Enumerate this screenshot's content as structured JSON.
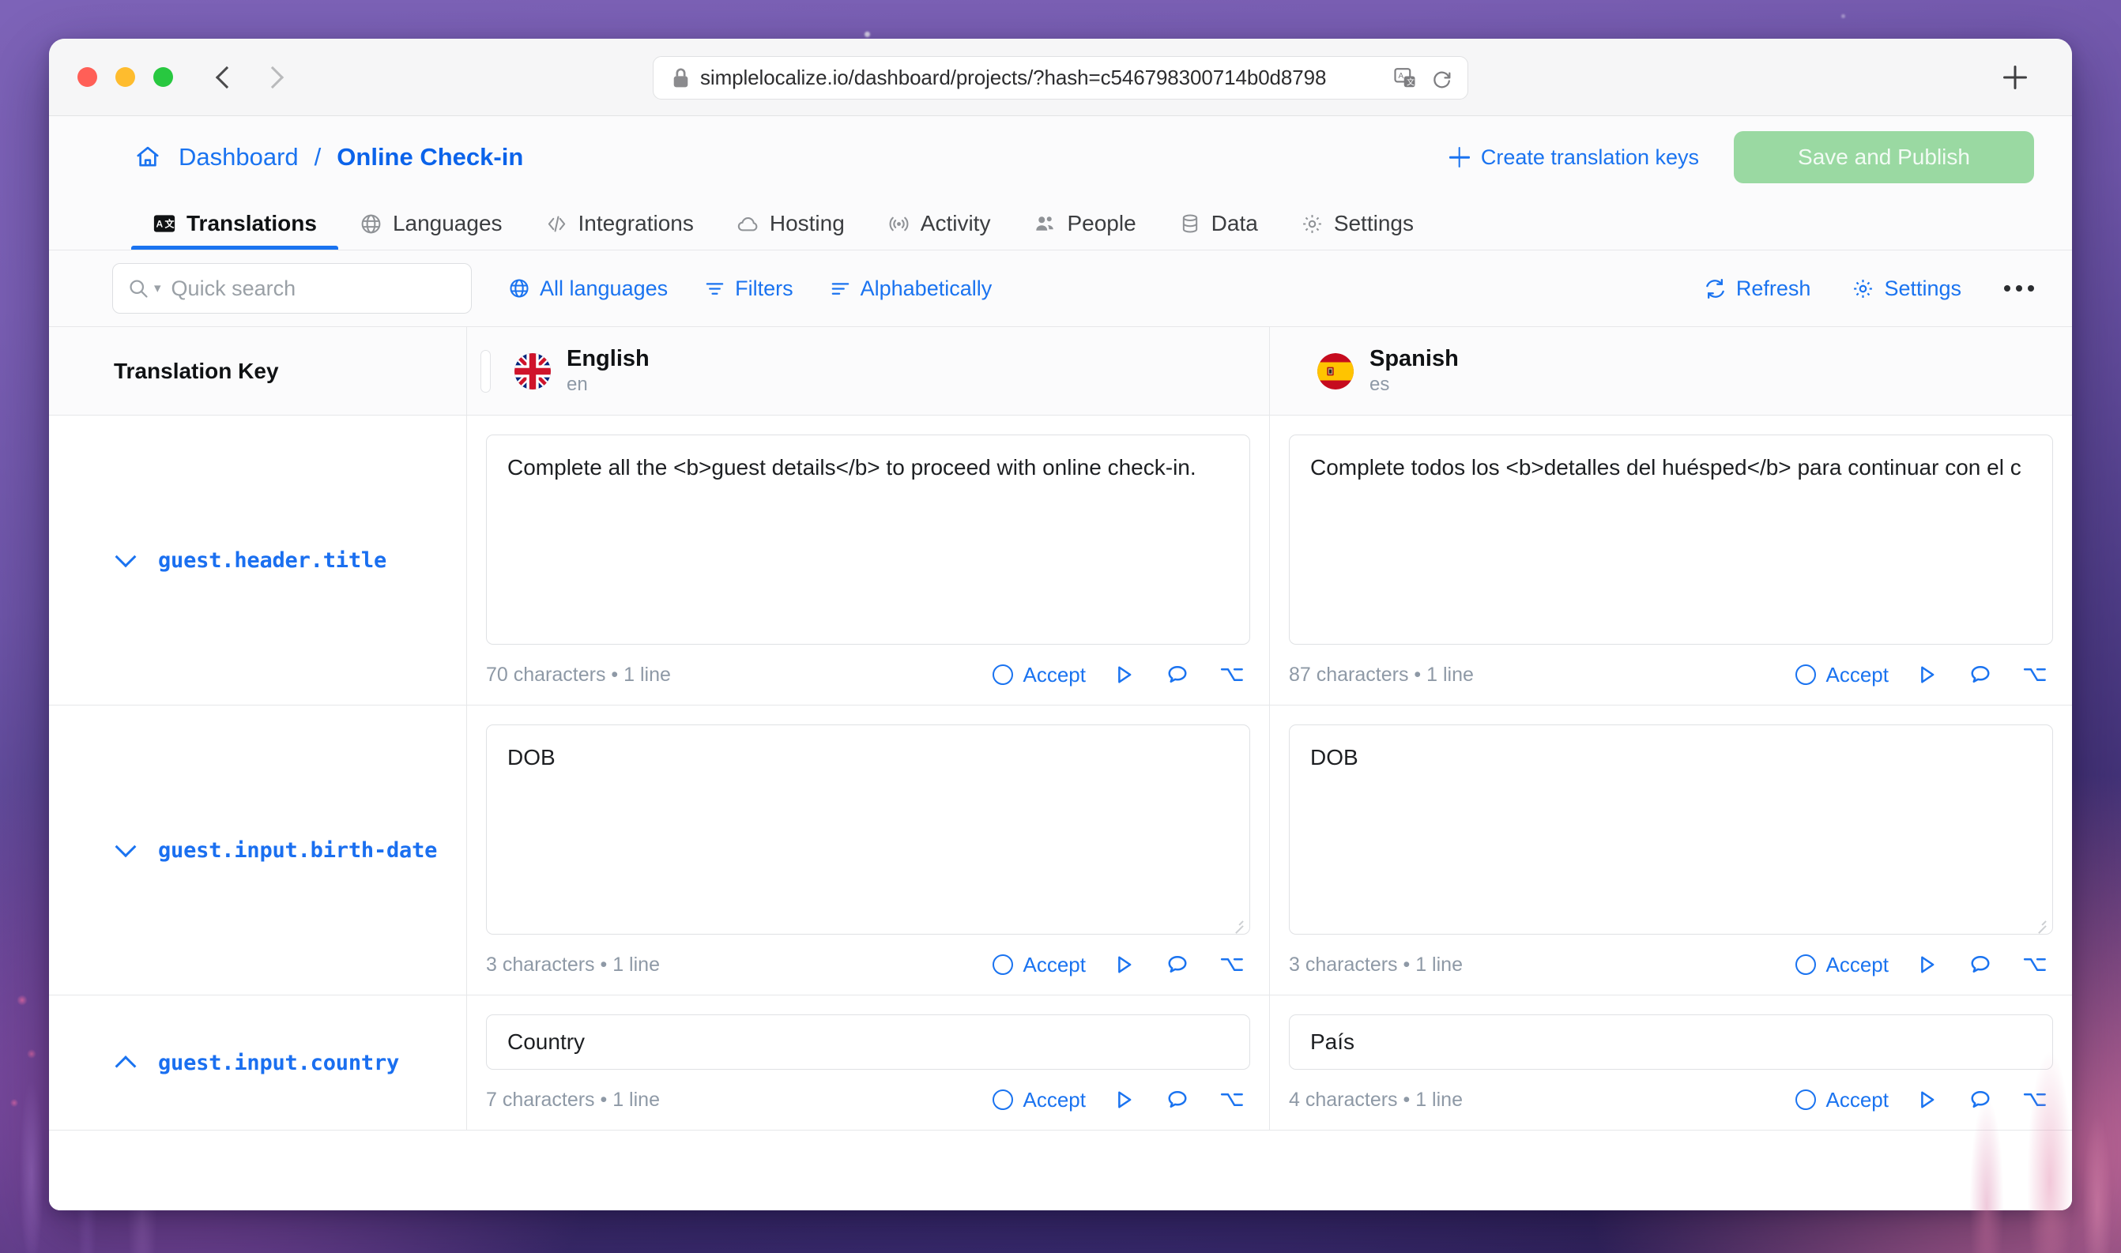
{
  "browser": {
    "url": "simplelocalize.io/dashboard/projects/?hash=c546798300714b0d8798",
    "lock_icon": "lock-icon",
    "translate_icon": "translate-page-icon",
    "reload_icon": "reload-icon",
    "back_icon": "back-chevron-icon",
    "forward_icon": "forward-chevron-icon",
    "new_tab_icon": "plus-icon"
  },
  "header": {
    "home_icon": "home-icon",
    "breadcrumb_root": "Dashboard",
    "breadcrumb_separator": "/",
    "breadcrumb_current": "Online Check-in",
    "create_keys_label": "Create translation keys",
    "save_publish_label": "Save and Publish",
    "save_publish_color": "#9ad9a2",
    "accent_color": "#1a73f0"
  },
  "tabs": [
    {
      "label": "Translations",
      "icon": "translate-box-icon",
      "active": true
    },
    {
      "label": "Languages",
      "icon": "globe-icon",
      "active": false
    },
    {
      "label": "Integrations",
      "icon": "code-brackets-icon",
      "active": false
    },
    {
      "label": "Hosting",
      "icon": "cloud-icon",
      "active": false
    },
    {
      "label": "Activity",
      "icon": "broadcast-icon",
      "active": false
    },
    {
      "label": "People",
      "icon": "people-icon",
      "active": false
    },
    {
      "label": "Data",
      "icon": "database-icon",
      "active": false
    },
    {
      "label": "Settings",
      "icon": "gear-icon",
      "active": false
    }
  ],
  "toolbar": {
    "search_placeholder": "Quick search",
    "search_value": "",
    "search_icon": "search-icon",
    "all_languages_label": "All languages",
    "filters_label": "Filters",
    "sort_label": "Alphabetically",
    "refresh_label": "Refresh",
    "settings_label": "Settings",
    "more_label": "•••"
  },
  "grid": {
    "key_column_header": "Translation Key",
    "languages": [
      {
        "name": "English",
        "code": "en",
        "flag": "flag-gb-icon"
      },
      {
        "name": "Spanish",
        "code": "es",
        "flag": "flag-es-icon"
      }
    ],
    "footer_labels": {
      "accept": "Accept",
      "play_icon": "play-icon",
      "comment_icon": "comment-icon",
      "option_icon": "option-key-icon",
      "accept_icon": "accept-circle-icon"
    },
    "rows": [
      {
        "key": "guest.header.title",
        "expanded": true,
        "chevron": "chevron-down-icon",
        "size": "tall",
        "cells": [
          {
            "value": "Complete all the <b>guest details</b> to proceed with online check-in.",
            "meta": "70 characters • 1 line",
            "accept": "Accept"
          },
          {
            "value": "Complete todos los <b>detalles del huésped</b> para continuar con el c",
            "meta": "87 characters • 1 line",
            "accept": "Accept"
          }
        ]
      },
      {
        "key": "guest.input.birth-date",
        "expanded": true,
        "chevron": "chevron-down-icon",
        "size": "tall",
        "cells": [
          {
            "value": "DOB",
            "meta": "3 characters • 1 line",
            "accept": "Accept"
          },
          {
            "value": "DOB",
            "meta": "3 characters • 1 line",
            "accept": "Accept"
          }
        ]
      },
      {
        "key": "guest.input.country",
        "expanded": false,
        "chevron": "chevron-up-icon",
        "size": "short",
        "cells": [
          {
            "value": "Country",
            "meta": "7 characters • 1 line",
            "accept": "Accept"
          },
          {
            "value": "País",
            "meta": "4 characters • 1 line",
            "accept": "Accept"
          }
        ]
      }
    ]
  }
}
